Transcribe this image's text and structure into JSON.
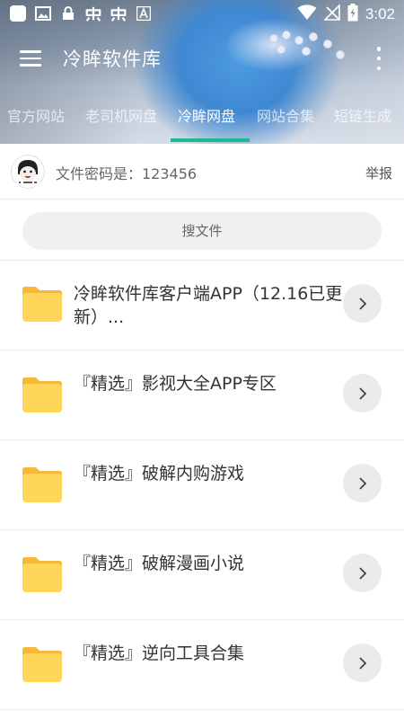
{
  "status_bar": {
    "time": "3:02",
    "icons": [
      "app-icon",
      "image-icon",
      "lock-icon",
      "notification-icon",
      "notification-icon",
      "font-icon",
      "wifi-icon",
      "no-signal-icon",
      "battery-charging-icon"
    ]
  },
  "toolbar": {
    "title": "冷眸软件库"
  },
  "tabs": [
    "官方网站",
    "老司机网盘",
    "冷眸网盘",
    "网站合集",
    "短链生成"
  ],
  "active_tab_index": 2,
  "password_row": {
    "text": "文件密码是：123456",
    "report_label": "举报"
  },
  "search": {
    "placeholder": "搜文件"
  },
  "files": [
    {
      "name": "冷眸软件库客户端APP（12.16已更新）..."
    },
    {
      "name": "『精选』影视大全APP专区"
    },
    {
      "name": "『精选』破解内购游戏"
    },
    {
      "name": "『精选』破解漫画小说"
    },
    {
      "name": "『精选』逆向工具合集"
    }
  ],
  "colors": {
    "accent": "#1fb98f",
    "folder": "#ffd659",
    "folder_tab": "#f5b93a"
  }
}
